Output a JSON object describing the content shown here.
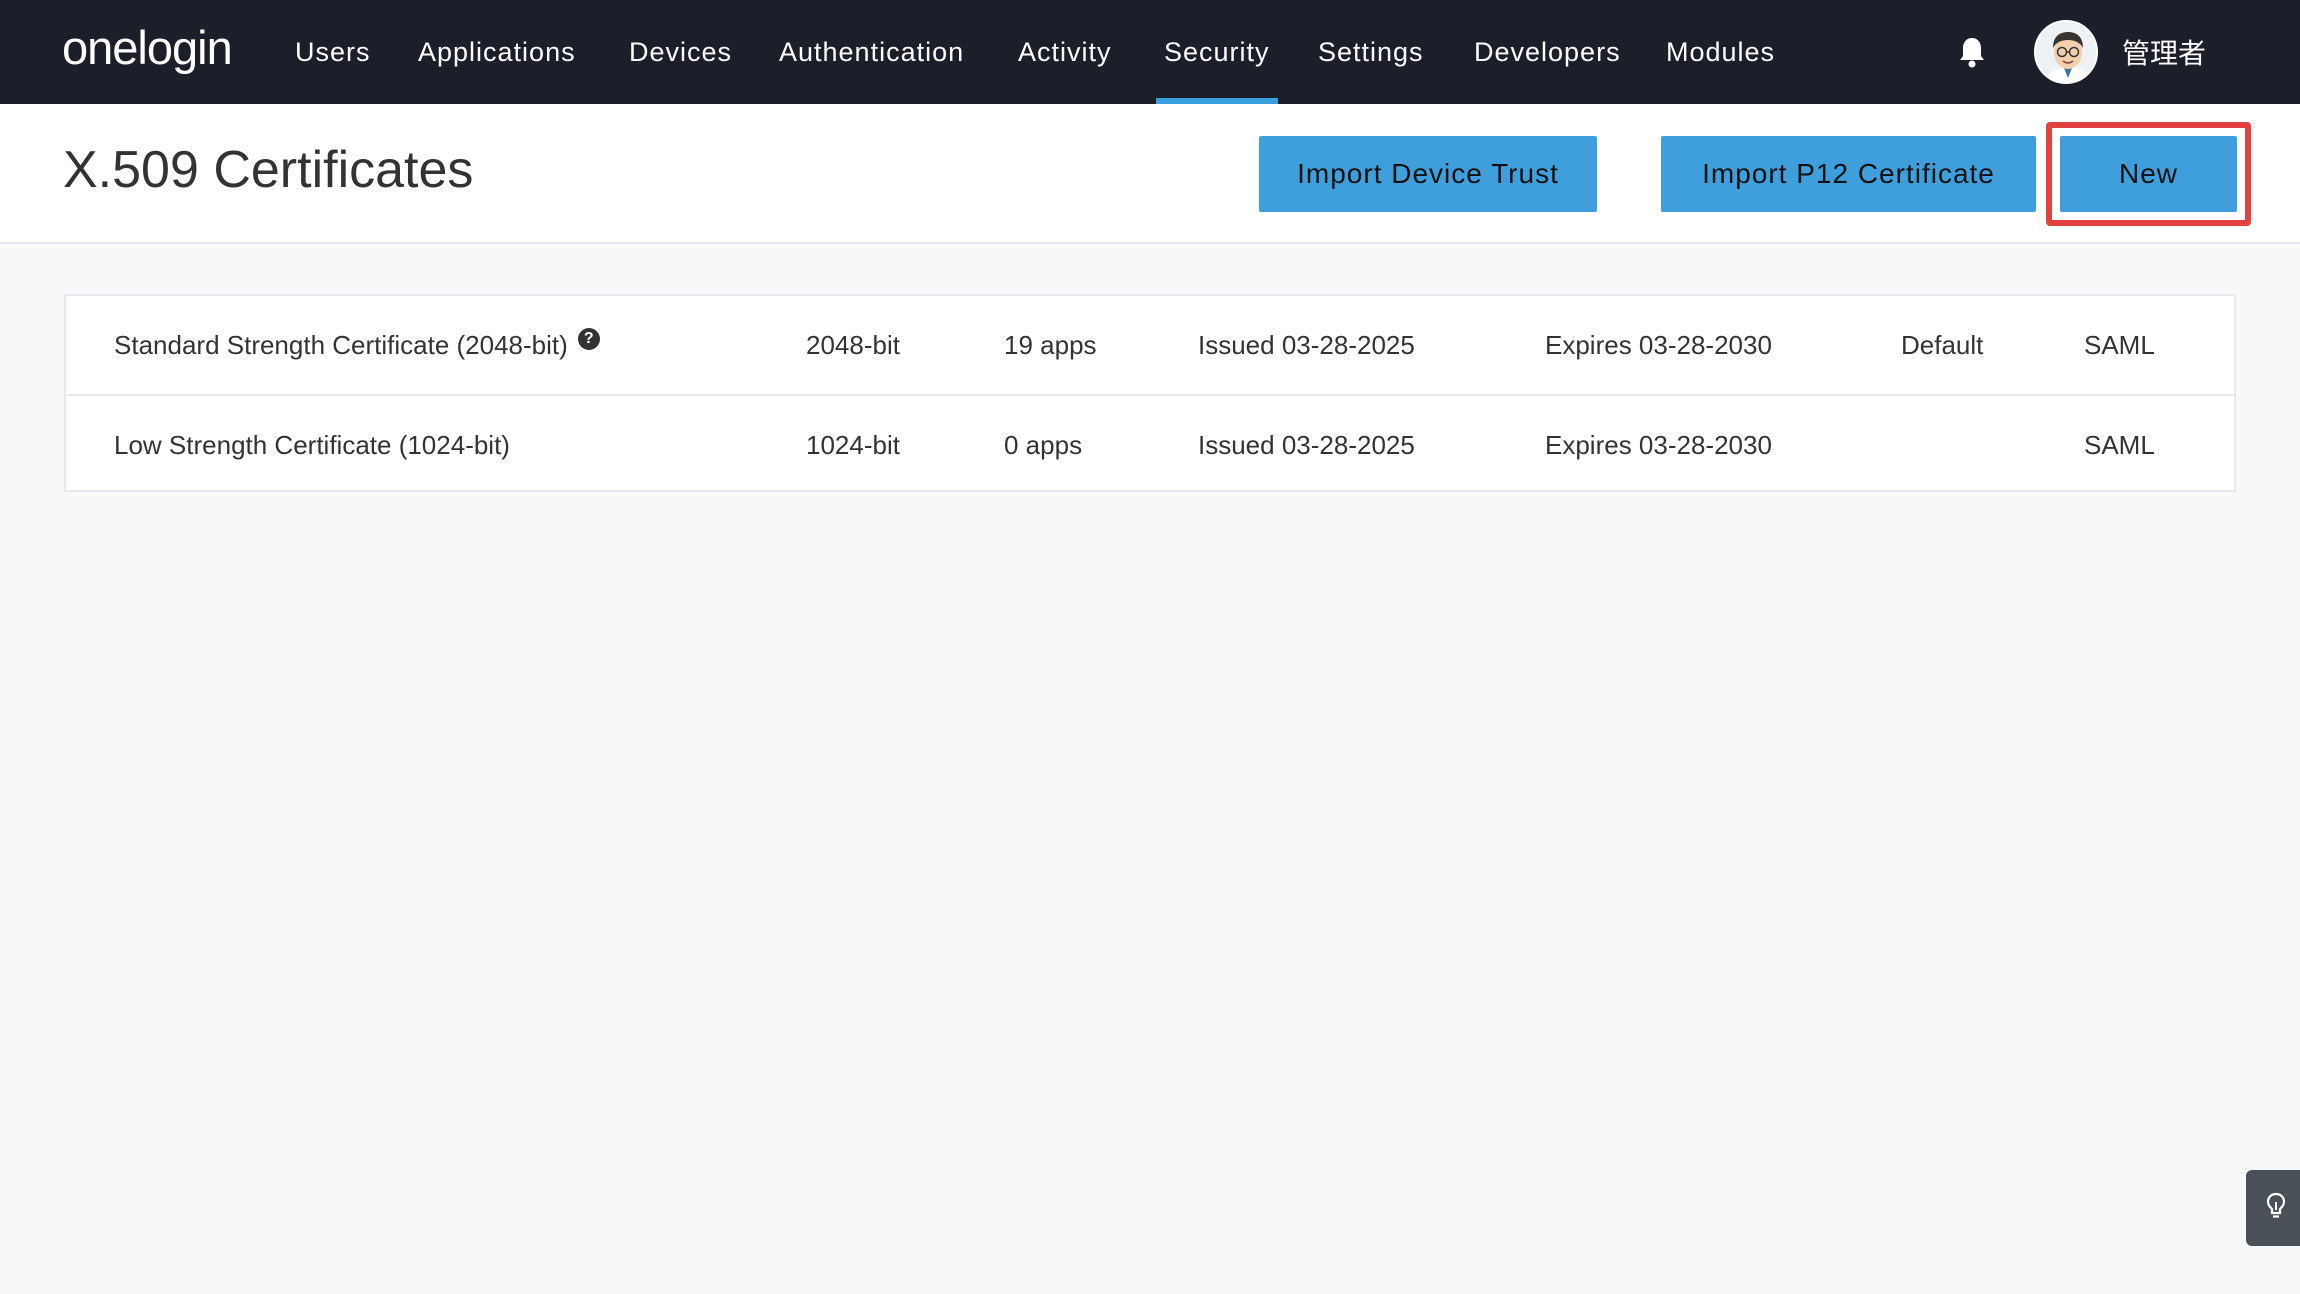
{
  "nav": {
    "logo": "onelogin",
    "items": [
      {
        "label": "Users"
      },
      {
        "label": "Applications"
      },
      {
        "label": "Devices"
      },
      {
        "label": "Authentication"
      },
      {
        "label": "Activity"
      },
      {
        "label": "Security",
        "active": true
      },
      {
        "label": "Settings"
      },
      {
        "label": "Developers"
      },
      {
        "label": "Modules"
      }
    ],
    "user_name": "管理者"
  },
  "page": {
    "title": "X.509 Certificates",
    "buttons": {
      "import_device_trust": "Import Device Trust",
      "import_p12": "Import P12 Certificate",
      "new": "New"
    }
  },
  "certificates": [
    {
      "name": "Standard Strength Certificate (2048-bit)",
      "help_icon": "?",
      "strength": "2048-bit",
      "apps": "19 apps",
      "issued": "Issued 03-28-2025",
      "expires": "Expires 03-28-2030",
      "default": "Default",
      "type": "SAML"
    },
    {
      "name": "Low Strength Certificate (1024-bit)",
      "strength": "1024-bit",
      "apps": "0 apps",
      "issued": "Issued 03-28-2025",
      "expires": "Expires 03-28-2030",
      "default": "",
      "type": "SAML"
    }
  ],
  "colors": {
    "nav_bg": "#1c1f2a",
    "accent": "#3f9fdc",
    "highlight": "#e2423f",
    "page_bg": "#f7f8fa"
  },
  "icons": {
    "notifications": "bell-icon",
    "help": "question-circle-icon",
    "tips": "lightbulb-icon"
  }
}
